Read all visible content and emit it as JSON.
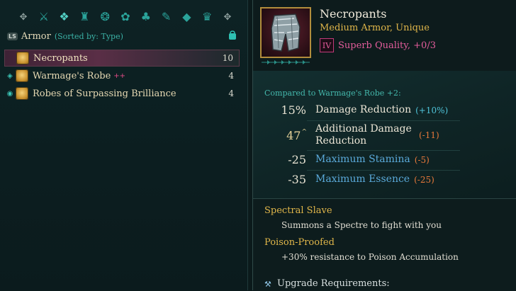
{
  "categories": [
    {
      "name": "all-items-icon",
      "glyph": "✥",
      "state": "dim"
    },
    {
      "name": "weapons-icon",
      "glyph": "⚔",
      "state": "normal"
    },
    {
      "name": "armor-icon",
      "glyph": "❖",
      "state": "active"
    },
    {
      "name": "boots-icon",
      "glyph": "♜",
      "state": "normal"
    },
    {
      "name": "rings-icon",
      "glyph": "❂",
      "state": "normal"
    },
    {
      "name": "consumables-icon",
      "glyph": "✿",
      "state": "normal"
    },
    {
      "name": "materials-icon",
      "glyph": "♣",
      "state": "normal"
    },
    {
      "name": "tools-icon",
      "glyph": "✎",
      "state": "normal"
    },
    {
      "name": "gems-icon",
      "glyph": "◆",
      "state": "normal"
    },
    {
      "name": "valuables-icon",
      "glyph": "♛",
      "state": "normal"
    },
    {
      "name": "misc-icon",
      "glyph": "✥",
      "state": "dim"
    }
  ],
  "header": {
    "badge": "LS",
    "title": "Armor",
    "sort": "(Sorted by: Type)"
  },
  "items": [
    {
      "name": "Necropants",
      "plus": "",
      "value": "10",
      "mark": "",
      "selected": true
    },
    {
      "name": "Warmage's Robe",
      "plus": "++",
      "value": "4",
      "mark": "◈",
      "selected": false
    },
    {
      "name": "Robes of Surpassing Brilliance",
      "plus": "",
      "value": "4",
      "mark": "◉",
      "selected": false
    }
  ],
  "detail": {
    "name": "Necropants",
    "type": "Medium Armor, Unique",
    "tier": "IV",
    "quality": "Superb Quality, +0/3",
    "compared": "Compared to Warmage's Robe +2:",
    "stats": [
      {
        "num": "15%",
        "caret": "",
        "label": "Damage Reduction",
        "diff": "(+10%)",
        "diff_kind": "pos",
        "label_color": "white"
      },
      {
        "num": "47",
        "caret": "^",
        "label": "Additional Damage Reduction",
        "diff": "(-11)",
        "diff_kind": "neg",
        "label_color": "white"
      },
      {
        "num": "-25",
        "caret": "",
        "label": "Maximum Stamina",
        "diff": "(-5)",
        "diff_kind": "neg",
        "label_color": "blue"
      },
      {
        "num": "-35",
        "caret": "",
        "label": "Maximum Essence",
        "diff": "(-25)",
        "diff_kind": "neg",
        "label_color": "blue"
      }
    ],
    "perks": [
      {
        "title": "Spectral Slave",
        "desc": "Summons a Spectre to fight with you"
      },
      {
        "title": "Poison-Proofed",
        "desc": "+30% resistance to Poison Accumulation"
      }
    ],
    "upgrade": "Upgrade Requirements:"
  },
  "colors": {
    "accent": "#2aa39a",
    "gold": "#e0b64a",
    "pink": "#e45d9c",
    "blue": "#5aa9d9",
    "orange": "#e6783a"
  }
}
